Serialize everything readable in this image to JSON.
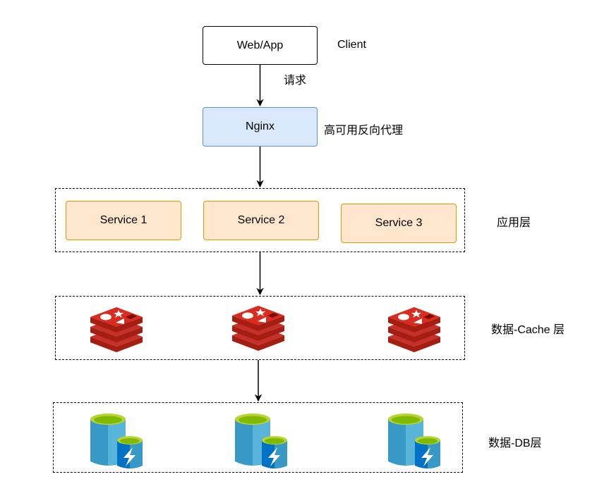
{
  "client": {
    "label": "Web/App",
    "side_label": "Client"
  },
  "request_label": "请求",
  "proxy": {
    "label": "Nginx",
    "side_label": "高可用反向代理"
  },
  "app_layer": {
    "label": "应用层",
    "services": [
      {
        "label": "Service 1"
      },
      {
        "label": "Service 2"
      },
      {
        "label": "Service 3"
      }
    ]
  },
  "cache_layer": {
    "label": "数据-Cache 层",
    "nodes": [
      "redis-icon",
      "redis-icon",
      "redis-icon"
    ]
  },
  "db_layer": {
    "label": "数据-DB层",
    "nodes": [
      "database-icon",
      "database-icon",
      "database-icon"
    ]
  },
  "colors": {
    "proxy_fill": "#dae8fc",
    "proxy_stroke": "#6c8ebf",
    "service_fill": "#ffe6cc",
    "service_stroke": "#d79b00",
    "redis_red": "#c6302b",
    "db_blue": "#3999c6",
    "db_green": "#7fba00"
  }
}
